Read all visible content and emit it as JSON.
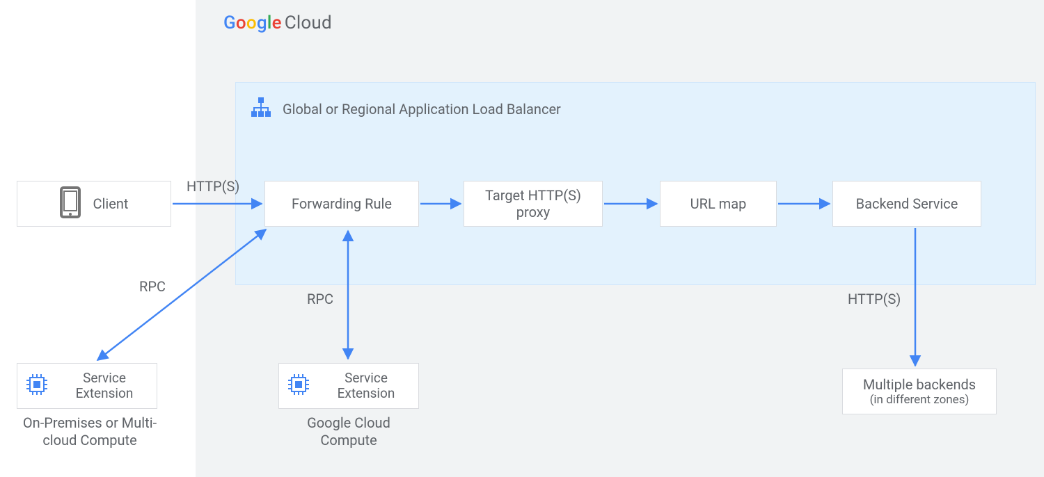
{
  "logo": {
    "brand": "Google",
    "product": "Cloud"
  },
  "lb": {
    "title": "Global or Regional Application Load Balancer"
  },
  "nodes": {
    "client": "Client",
    "forwarding_rule": "Forwarding Rule",
    "target_proxy": "Target HTTP(S) proxy",
    "url_map": "URL map",
    "backend_service": "Backend Service",
    "service_extension": "Service Extension",
    "multiple_backends": "Multiple backends",
    "multiple_backends_sub": "(in different zones)"
  },
  "sublabels": {
    "onprem": "On-Premises or Multi-cloud Compute",
    "gcc": "Google Cloud Compute"
  },
  "edges": {
    "https": "HTTP(S)",
    "rpc": "RPC"
  }
}
